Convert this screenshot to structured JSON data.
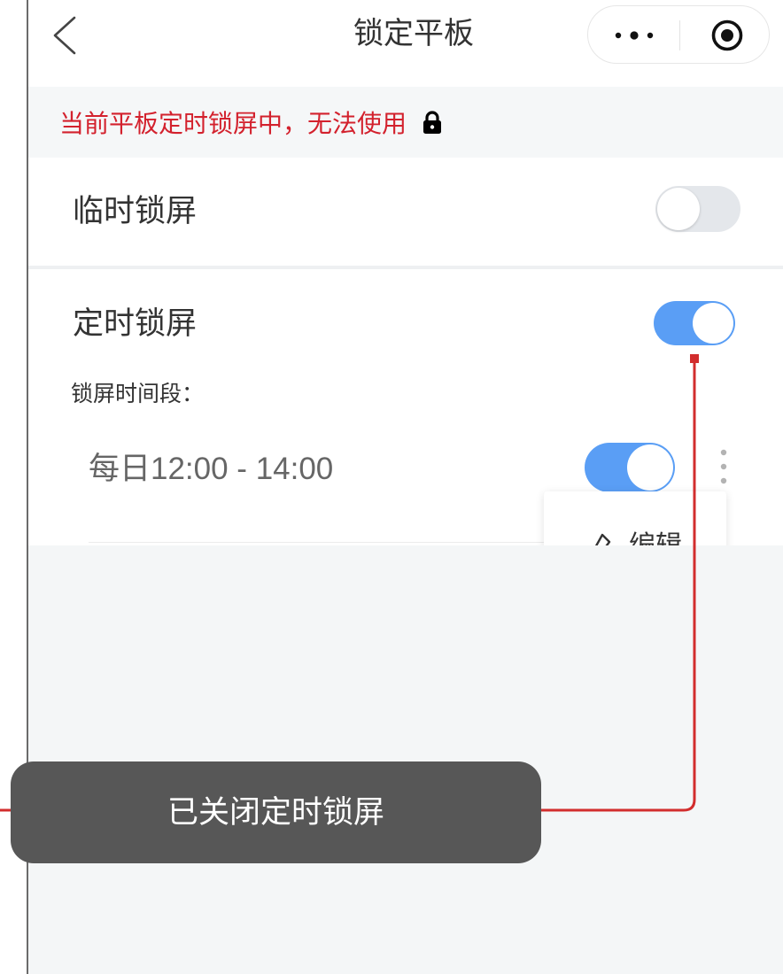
{
  "header": {
    "title": "锁定平板",
    "back_icon": "chevron-left-icon",
    "capsule": {
      "more_icon": "more-dots-icon",
      "close_icon": "target-icon"
    }
  },
  "notice": {
    "text": "当前平板定时锁屏中，无法使用",
    "icon": "lock-icon"
  },
  "temporary_lock": {
    "label": "临时锁屏",
    "enabled": false
  },
  "scheduled_lock": {
    "label": "定时锁屏",
    "enabled": true,
    "period_label": "锁屏时间段：",
    "periods": [
      {
        "text": "每日12:00 - 14:00",
        "enabled": true,
        "more_icon": "kebab-icon"
      }
    ],
    "menu": {
      "items": [
        {
          "label": "编辑",
          "icon": "edit-icon"
        }
      ]
    }
  },
  "toast": {
    "text": "已关闭定时锁屏"
  },
  "colors": {
    "accent": "#5a9ef5",
    "notice": "#d3212d",
    "toast": "#575757",
    "annotation": "#d22d2d",
    "page_gray": "#f4f6f7"
  }
}
